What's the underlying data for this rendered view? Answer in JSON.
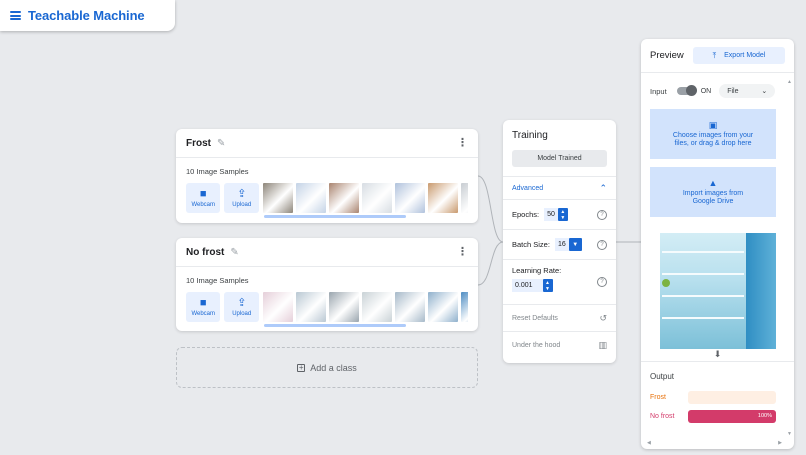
{
  "app": {
    "title": "Teachable Machine"
  },
  "classes": [
    {
      "name": "Frost",
      "sample_count": "10 Image Samples",
      "webcam_label": "Webcam",
      "upload_label": "Upload",
      "thumb_colors": [
        "#8d8579",
        "#c4d3e6",
        "#a9846f",
        "#d7dde3",
        "#b0c2dc",
        "#c99a6e",
        "#c8cdd2"
      ]
    },
    {
      "name": "No frost",
      "sample_count": "10 Image Samples",
      "webcam_label": "Webcam",
      "upload_label": "Upload",
      "thumb_colors": [
        "#e5cfd9",
        "#b9c8d3",
        "#9aa5ae",
        "#c9d2d6",
        "#a6b9c9",
        "#8fb0cc",
        "#4d8cc2"
      ]
    }
  ],
  "add_class": {
    "label": "Add a class"
  },
  "training": {
    "title": "Training",
    "train_button": "Model Trained",
    "advanced_label": "Advanced",
    "epochs": {
      "label": "Epochs:",
      "value": "50"
    },
    "batch_size": {
      "label": "Batch Size:",
      "value": "16"
    },
    "learning_rate": {
      "label": "Learning Rate:",
      "value": "0.001"
    },
    "reset_label": "Reset Defaults",
    "hood_label": "Under the hood"
  },
  "preview": {
    "title": "Preview",
    "export_label": "Export Model",
    "input_label": "Input",
    "toggle_state": "ON",
    "source_select": "File",
    "choose_files_line1": "Choose images from your",
    "choose_files_line2": "files, or drag & drop here",
    "drive_line1": "Import images from",
    "drive_line2": "Google Drive",
    "output_title": "Output",
    "outputs": [
      {
        "label": "Frost",
        "percent": 0,
        "percent_text": "",
        "color": "#e8710a",
        "track_color": "#feefe3"
      },
      {
        "label": "No frost",
        "percent": 100,
        "percent_text": "100%",
        "color": "#d33b6a",
        "track_color": "#fce8ee"
      }
    ]
  },
  "colors": {
    "accent": "#1967d2",
    "accent_light": "#e8f0fe"
  }
}
